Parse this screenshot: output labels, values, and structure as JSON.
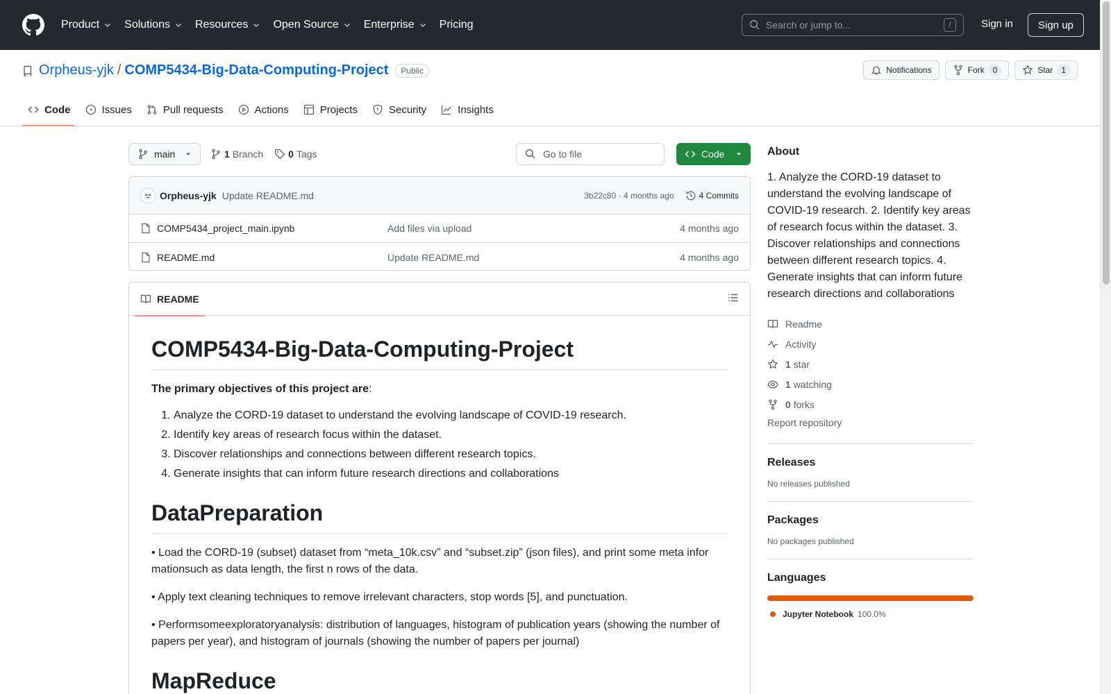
{
  "header": {
    "nav": [
      {
        "label": "Product",
        "dropdown": true
      },
      {
        "label": "Solutions",
        "dropdown": true
      },
      {
        "label": "Resources",
        "dropdown": true
      },
      {
        "label": "Open Source",
        "dropdown": true
      },
      {
        "label": "Enterprise",
        "dropdown": true
      },
      {
        "label": "Pricing",
        "dropdown": false
      }
    ],
    "search_placeholder": "Search or jump to...",
    "search_shortcut": "/",
    "sign_in": "Sign in",
    "sign_up": "Sign up"
  },
  "repo": {
    "owner": "Orpheus-yjk",
    "separator": "/",
    "name": "COMP5434-Big-Data-Computing-Project",
    "visibility": "Public",
    "notifications_label": "Notifications",
    "fork_label": "Fork",
    "fork_count": "0",
    "star_label": "Star",
    "star_count": "1"
  },
  "tabs": [
    {
      "label": "Code",
      "icon": "code-icon",
      "active": true
    },
    {
      "label": "Issues",
      "icon": "issue-icon",
      "active": false
    },
    {
      "label": "Pull requests",
      "icon": "pull-request-icon",
      "active": false
    },
    {
      "label": "Actions",
      "icon": "actions-icon",
      "active": false
    },
    {
      "label": "Projects",
      "icon": "projects-icon",
      "active": false
    },
    {
      "label": "Security",
      "icon": "shield-icon",
      "active": false
    },
    {
      "label": "Insights",
      "icon": "graph-icon",
      "active": false
    }
  ],
  "branch": {
    "current": "main",
    "branch_count": "1",
    "branch_label": "Branch",
    "tag_count": "0",
    "tag_label": "Tags",
    "goto_placeholder": "Go to file",
    "code_label": "Code"
  },
  "latest_commit": {
    "author": "Orpheus-yjk",
    "message": "Update README.md",
    "hash_age": "3b22c80 · 4 months ago",
    "commits_label": "4 Commits"
  },
  "files": [
    {
      "name": "COMP5434_project_main.ipynb",
      "message": "Add files via upload",
      "age": "4 months ago"
    },
    {
      "name": "README.md",
      "message": "Update README.md",
      "age": "4 months ago"
    }
  ],
  "readme": {
    "tab_label": "README",
    "title": "COMP5434-Big-Data-Computing-Project",
    "intro_bold": "The primary objectives of this project are",
    "intro_tail": ":",
    "objectives": [
      "Analyze the CORD-19 dataset to understand the evolving landscape of COVID-19 research.",
      "Identify key areas of research focus within the dataset.",
      "Discover relationships and connections between different research topics.",
      "Generate insights that can inform future research directions and collaborations"
    ],
    "section1_title": "DataPreparation",
    "section1_paragraphs": [
      "• Load the CORD-19 (subset) dataset from “meta_10k.csv” and “subset.zip” (json files), and print some meta infor mationsuch as data length, the first n rows of the data.",
      "• Apply text cleaning techniques to remove irrelevant characters, stop words [5], and punctuation.",
      "• Performsomeexploratoryanalysis: distribution of languages, histogram of publication years (showing the number of papers per year), and histogram of journals (showing the number of papers per journal)"
    ],
    "section2_title": "MapReduce"
  },
  "sidebar": {
    "about_title": "About",
    "about_text": "1. Analyze the CORD-19 dataset to understand the evolving landscape of COVID-19 research. 2. Identify key areas of research focus within the dataset. 3. Discover relationships and connections between different research topics. 4. Generate insights that can inform future research directions and collaborations",
    "links": [
      {
        "icon": "book-icon",
        "count": "",
        "label": "Readme"
      },
      {
        "icon": "pulse-icon",
        "count": "",
        "label": "Activity"
      },
      {
        "icon": "star-icon",
        "count": "1",
        "label": "star"
      },
      {
        "icon": "eye-icon",
        "count": "1",
        "label": "watching"
      },
      {
        "icon": "fork-icon",
        "count": "0",
        "label": "forks"
      }
    ],
    "report": "Report repository",
    "releases_title": "Releases",
    "releases_text": "No releases published",
    "packages_title": "Packages",
    "packages_text": "No packages published",
    "languages_title": "Languages",
    "languages": [
      {
        "name": "Jupyter Notebook",
        "percent": "100.0%",
        "fraction": 1.0,
        "color": "#DA5B0B"
      }
    ]
  },
  "colors": {
    "header_bg": "#24292f",
    "link": "#0969da",
    "code_button": "#1f883d",
    "tab_underline": "#fd8c73"
  }
}
